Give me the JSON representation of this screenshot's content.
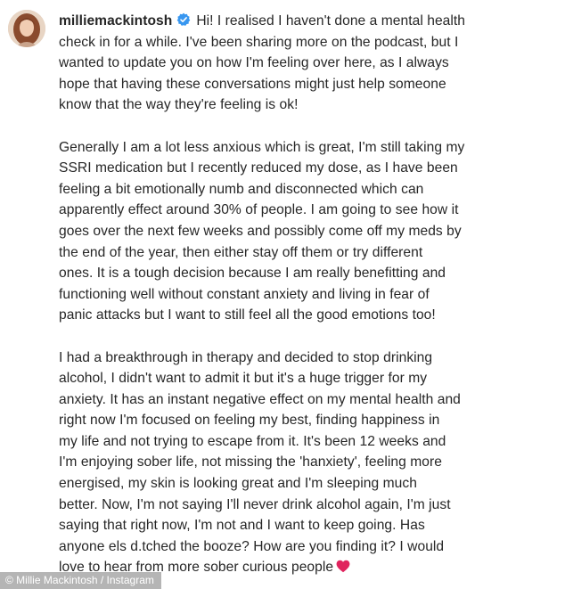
{
  "post": {
    "username": "milliemackintosh",
    "verified": true,
    "paragraphs": [
      [
        "Hi! I realised I haven't done a mental health",
        "check in for a while. I've been sharing more on the podcast, but I",
        "wanted to update you on how I'm feeling over here, as I always",
        "hope that having these conversations might just help someone",
        "know that the way they're feeling is ok!"
      ],
      [
        "Generally I am a lot less anxious which is great, I'm still taking my",
        "SSRI medication but I recently reduced my dose, as I have been",
        "feeling a bit emotionally numb and disconnected which can",
        "apparently effect around 30% of people. I am going to see how it",
        "goes over the next few weeks and possibly come off my meds by",
        "the end of the year, then either stay off them or try different",
        "ones. It is a tough decision because I am really benefitting and",
        "functioning well without constant anxiety and living in fear of",
        "panic attacks but I want to still feel all the good emotions too!"
      ],
      [
        "I had a breakthrough in therapy and decided to stop drinking",
        "alcohol, I didn't want to admit it but it's a huge trigger for my",
        "anxiety. It has an instant negative effect on my mental health and",
        "right now I'm focused on feeling my best, finding happiness in",
        "my life and not trying to escape from it. It's been 12 weeks and",
        "I'm enjoying sober life, not missing the 'hanxiety', feeling more",
        "energised, my skin is looking great and I'm sleeping much",
        "better.  Now, I'm not saying I'll never drink alcohol again, I'm just",
        "saying that right now, I'm not and I want to keep going. Has",
        "anyone els  d.tched the booze? How are you finding it? I would",
        "love to hear from more sober curious people"
      ]
    ],
    "emoji": "heart-icon"
  },
  "credit": "© Millie Mackintosh / Instagram",
  "colors": {
    "text": "#262626",
    "verified": "#3897f0",
    "heart": "#e0245e"
  }
}
